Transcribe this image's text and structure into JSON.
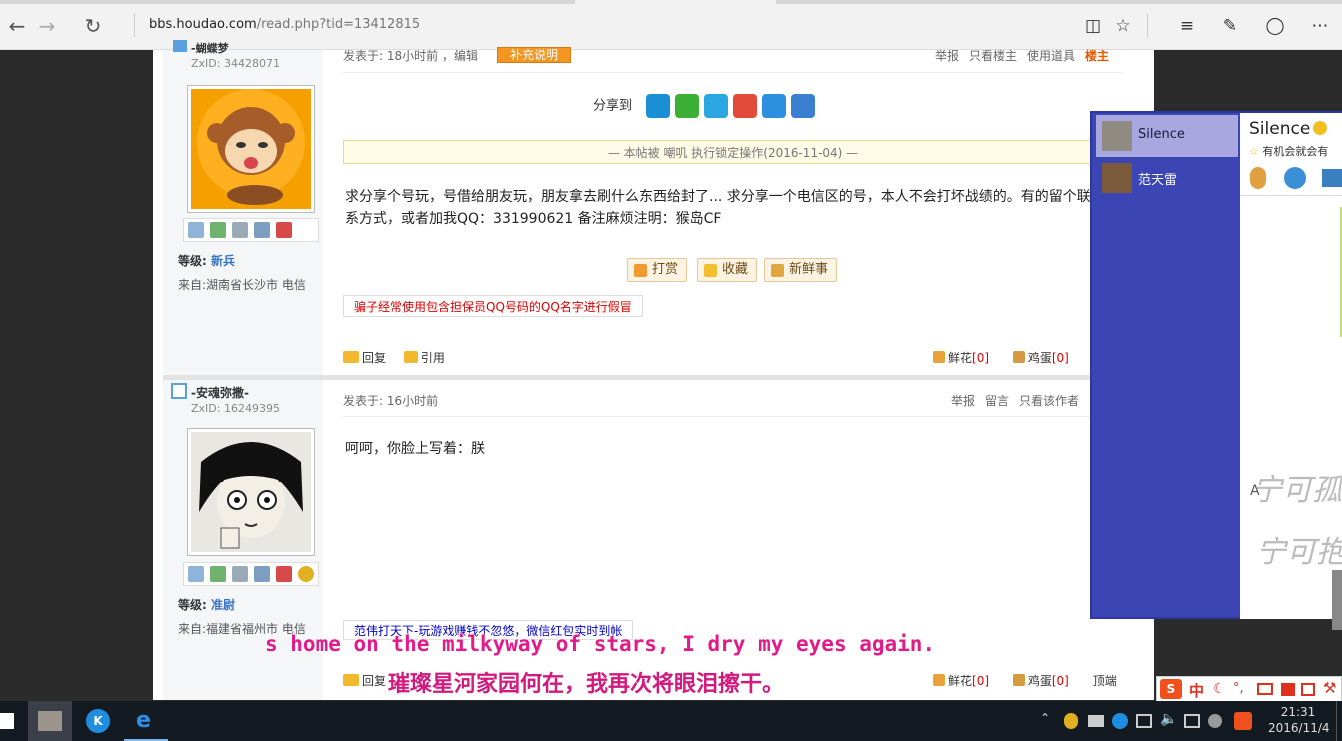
{
  "browser": {
    "url_host": "bbs.houdao.com",
    "url_path": "/read.php?tid=13412815"
  },
  "post1": {
    "username": "-蝴蝶梦",
    "zxid": "ZxID:  34428071",
    "level_label": "等级:",
    "level_value": "新兵",
    "from": "来自:湖南省长沙市 电信",
    "posted": "发表于: 18小时前",
    "edit": "，编辑",
    "supplement_button": "补充说明",
    "report": "举报",
    "only_op": "只看楼主",
    "use_tool": "使用道具",
    "floor": "楼主",
    "share_label": "分享到",
    "lock_notice": "— 本帖被 嘲叽  执行锁定操作(2016-11-04) —",
    "content_line1": "求分享个号玩，号借给朋友玩，朋友拿去刷什么东西给封了...    求分享一个电信区的号，本人不会打坏战绩的。有的留个联",
    "content_line2": "系方式，或者加我QQ：331990621    备注麻烦注明：猴岛CF",
    "tip_button": "打赏",
    "fav_button": "收藏",
    "fresh_button": "新鲜事",
    "warning": "骗子经常使用包含担保员QQ号码的QQ名字进行假冒",
    "reply": "回复",
    "quote": "引用",
    "flower": "鲜花",
    "flower_count": "[0]",
    "egg": "鸡蛋",
    "egg_count": "[0]"
  },
  "post2": {
    "username": "-安魂弥撒-",
    "zxid": "ZxID:  16249395",
    "level_label": "等级:",
    "level_value": "准尉",
    "from": "来自:福建省福州市 电信",
    "posted": "发表于: 16小时前",
    "report": "举报",
    "message": "留言",
    "only_author": "只看该作者",
    "content": "呵呵，你脸上写着：朕",
    "ad": "范伟打天下-玩游戏赚钱不忽悠，微信红包实时到帐",
    "reply": "回复",
    "flower": "鲜花",
    "flower_count": "[0]",
    "egg": "鸡蛋",
    "egg_count": "[0]",
    "top": "顶端"
  },
  "qq": {
    "contacts": [
      "Silence",
      "范天雷"
    ],
    "chat_name": "Silence",
    "chat_status": "有机会就会有",
    "hand_text1": "宁可孤",
    "hand_text2": "宁可抱",
    "input_letter": "A"
  },
  "subtitles": {
    "english": "s home on the milkyway of stars, I dry my eyes again.",
    "chinese": "璀璨星河家园何在，我再次将眼泪擦干。"
  },
  "ime": {
    "logo": "S",
    "mode": "中"
  },
  "clock": {
    "time": "21:31",
    "date": "2016/11/4"
  }
}
